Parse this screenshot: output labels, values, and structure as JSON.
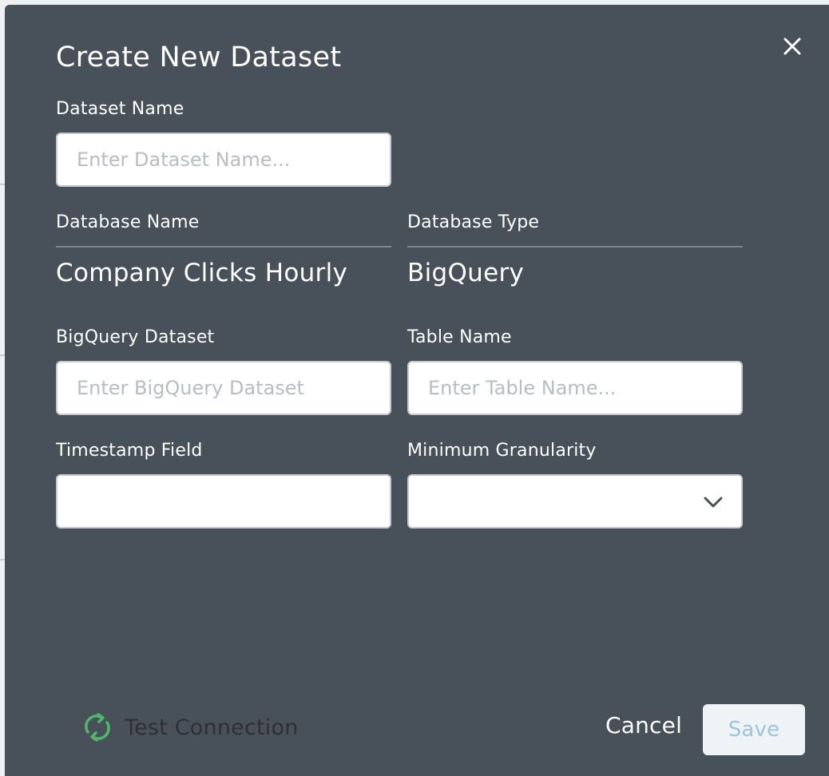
{
  "dialog": {
    "title": "Create New Dataset",
    "close_icon": "close-icon"
  },
  "fields": {
    "dataset_name": {
      "label": "Dataset Name",
      "value": "",
      "placeholder": "Enter Dataset Name..."
    },
    "database_name": {
      "label": "Database Name",
      "value": "Company Clicks Hourly"
    },
    "database_type": {
      "label": "Database Type",
      "value": "BigQuery"
    },
    "bigquery_dataset": {
      "label": "BigQuery Dataset",
      "value": "",
      "placeholder": "Enter BigQuery Dataset"
    },
    "table_name": {
      "label": "Table Name",
      "value": "",
      "placeholder": "Enter Table Name..."
    },
    "timestamp_field": {
      "label": "Timestamp Field",
      "value": ""
    },
    "minimum_granularity": {
      "label": "Minimum Granularity",
      "selected": "",
      "icon": "chevron-down-icon"
    }
  },
  "footer": {
    "test_connection_label": "Test Connection",
    "test_connection_icon": "refresh-icon",
    "cancel_label": "Cancel",
    "save_label": "Save"
  },
  "colors": {
    "dialog_background": "#485159",
    "test_icon_green": "#4fb86a",
    "save_text_disabled": "#9fc4da",
    "save_background": "#eef3f6"
  }
}
